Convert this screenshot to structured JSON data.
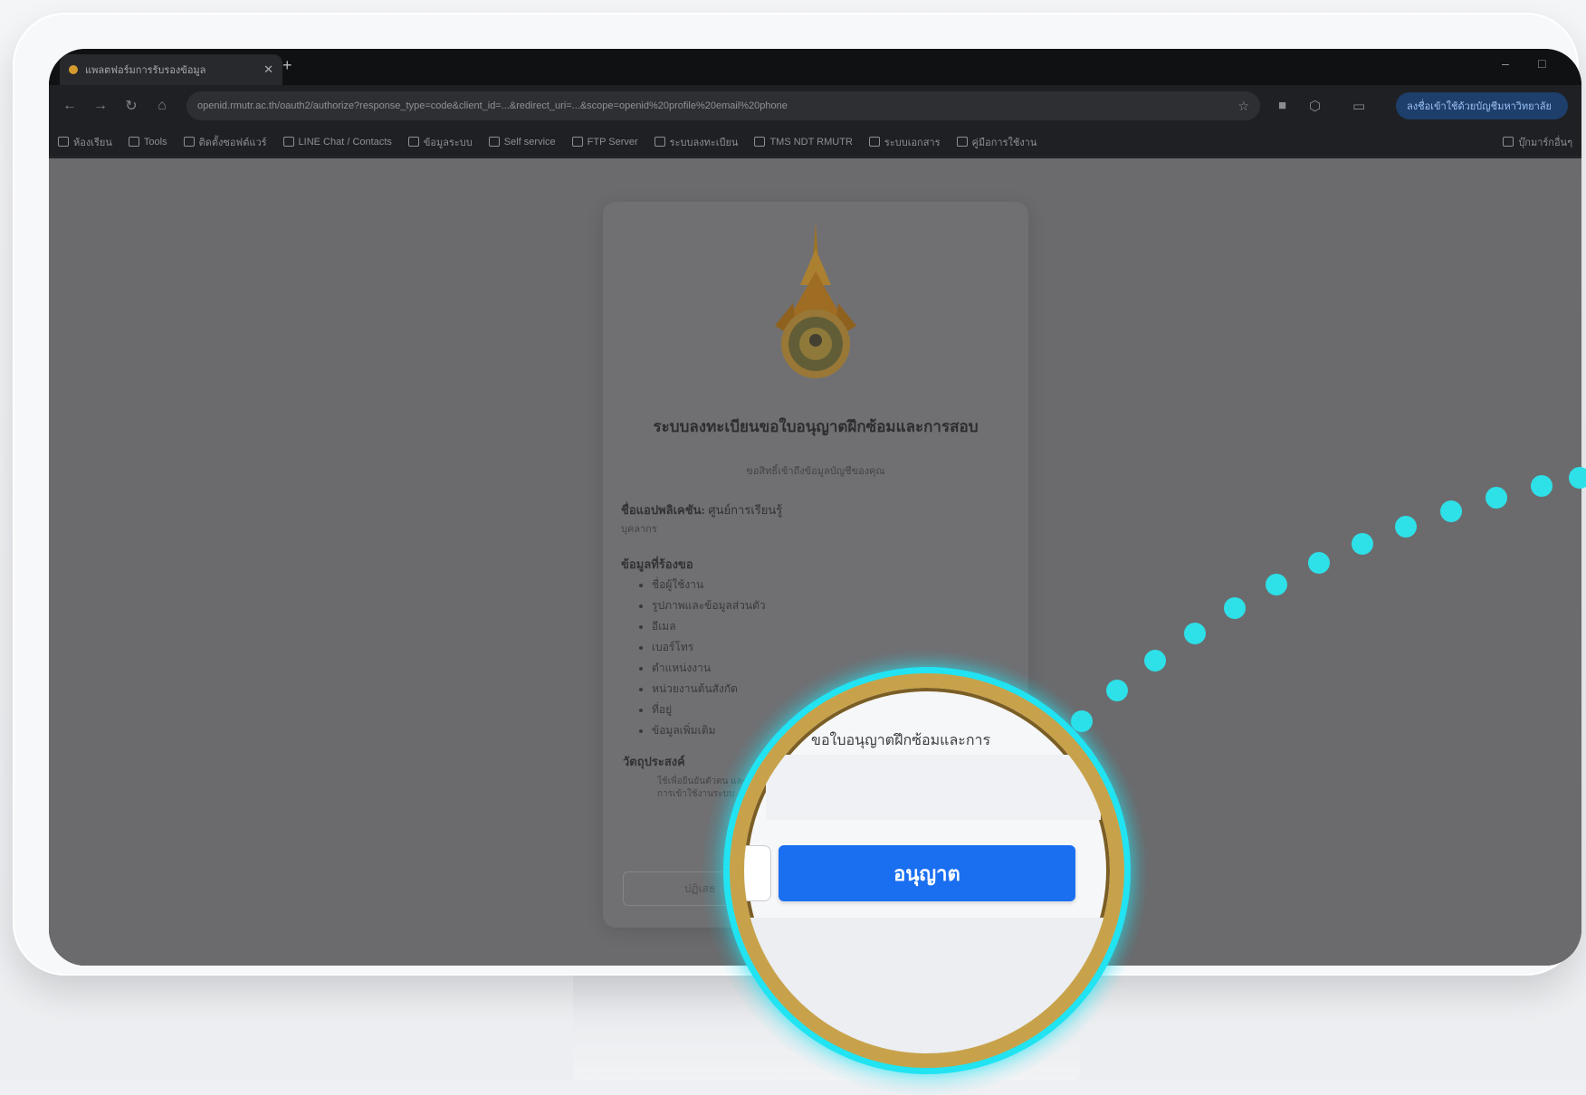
{
  "browser": {
    "tab_title": "แพลตฟอร์มการรับรองข้อมูล",
    "url": "openid.rmutr.ac.th/oauth2/authorize?response_type=code&client_id=...&redirect_uri=...&scope=openid%20profile%20email%20phone",
    "profile_label": "ลงชื่อเข้าใช้ด้วยบัญชีมหาวิทยาลัย",
    "bookmarks": [
      "ห้องเรียน",
      "Tools",
      "ติดตั้งซอฟต์แวร์",
      "LINE Chat / Contacts",
      "ข้อมูลระบบ",
      "Self service",
      "FTP Server",
      "ระบบลงทะเบียน",
      "TMS NDT RMUTR",
      "ระบบเอกสาร",
      "คู่มือการใช้งาน",
      "บุ๊กมาร์กอื่นๆ"
    ]
  },
  "consent": {
    "title": "ระบบลงทะเบียนขอใบอนุญาตฝึกซ้อมและการสอบ",
    "subtitle": "ขอสิทธิ์เข้าถึงข้อมูลบัญชีของคุณ",
    "app_label": "ชื่อแอปพลิเคชัน:",
    "app_name": "ศูนย์การเรียนรู้",
    "app_role": "บุคลากร",
    "scope_heading": "ข้อมูลที่ร้องขอ",
    "scopes": [
      "ชื่อผู้ใช้งาน",
      "รูปภาพและข้อมูลส่วนตัว",
      "อีเมล",
      "เบอร์โทร",
      "ตำแหน่งงาน",
      "หน่วยงานต้นสังกัด",
      "ที่อยู่",
      "ข้อมูลเพิ่มเติม"
    ],
    "purpose_heading": "วัตถุประสงค์",
    "purpose_text": "ใช้เพื่อยืนยันตัวตน และการเข้าใช้งานระบบ",
    "cancel_label": "ปฏิเสธ"
  },
  "magnified": {
    "description": "ขอใบอนุญาตฝึกซ้อมและการ",
    "allow_label": "อนุญาต"
  },
  "colors": {
    "allow_button": "#1a6ff0",
    "highlight_ring": "#21e3f2",
    "gold_ring": "#c8a24a",
    "connector_dots": "#2ee0e8"
  },
  "icons": [
    "back-icon",
    "forward-icon",
    "reload-icon",
    "home-icon",
    "star-icon",
    "extension-icon",
    "emblem-icon"
  ]
}
